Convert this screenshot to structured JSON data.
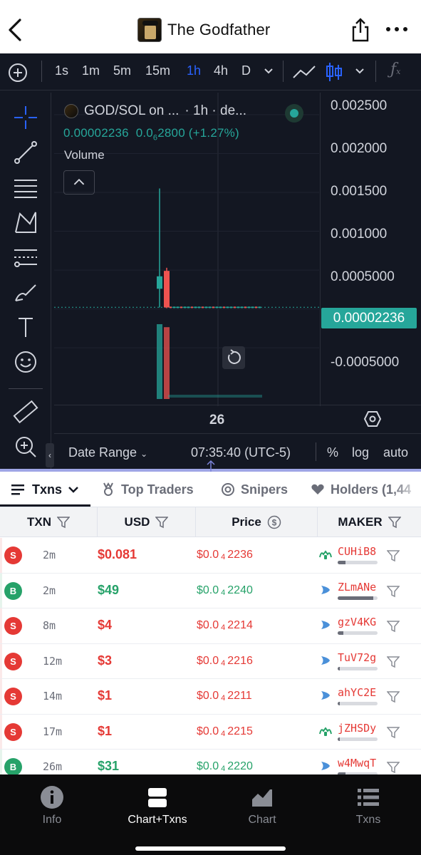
{
  "header": {
    "title": "The Godfather",
    "back_icon": "chevron-left-icon",
    "share_icon": "share-icon",
    "more_icon": "more-dots-icon"
  },
  "chart_toolbar": {
    "add_icon": "plus-circle-icon",
    "intervals": [
      "1s",
      "1m",
      "5m",
      "15m",
      "1h",
      "4h",
      "D"
    ],
    "active_interval": "1h",
    "interval_dropdown_icon": "chevron-down-icon",
    "chart_style_icon": "line-chart-icon",
    "candles_icon": "candles-icon",
    "indicators_icon": "fx-icon"
  },
  "left_tools": [
    "crosshair-icon",
    "trendline-icon",
    "horizontal-lines-icon",
    "pattern-icon",
    "fib-icon",
    "brush-icon",
    "text-icon",
    "emoji-icon",
    "ruler-icon",
    "zoom-in-icon"
  ],
  "chart_legend": {
    "symbol": "GOD/SOL on ...",
    "interval_source": "· 1h · de...",
    "price": "0.00002236",
    "change_prefix": "0.0",
    "change_sub": "6",
    "change_rest": "2800 (+1.27%)",
    "volume_label": "Volume"
  },
  "y_axis_labels": [
    "0.002500",
    "0.002000",
    "0.001500",
    "0.001000",
    "0.0005000",
    "-0.0005000"
  ],
  "last_price_label": "0.00002236",
  "x_axis_label": "26",
  "chart_footer": {
    "date_range": "Date Range",
    "time": "07:35:40 (UTC-5)",
    "percent": "%",
    "log": "log",
    "auto": "auto"
  },
  "chart_data": {
    "type": "candlestick",
    "ylim": [
      -0.0007,
      0.0026
    ],
    "y_ticks": [
      0.0025,
      0.002,
      0.0015,
      0.001,
      0.0005,
      -0.0005
    ],
    "last_price": 2.236e-05,
    "candles": [
      {
        "open": 0.00026,
        "close": 0.00042,
        "high": 0.00155,
        "low": 2e-05,
        "color": "green"
      },
      {
        "open": 0.00049,
        "close": 2e-05,
        "high": 0.00053,
        "low": 1e-05,
        "color": "red"
      }
    ],
    "volumes": [
      {
        "value": 1.0,
        "color": "green"
      },
      {
        "value": 0.96,
        "color": "red"
      }
    ]
  },
  "tabs": [
    {
      "label": "Txns",
      "icon": "list-icon"
    },
    {
      "label": "Top Traders",
      "icon": "medal-icon"
    },
    {
      "label": "Snipers",
      "icon": "target-icon"
    },
    {
      "label": "Holders (1,44",
      "icon": "heart-icon"
    }
  ],
  "table": {
    "headers": {
      "txn": "TXN",
      "usd": "USD",
      "price": "Price",
      "maker": "MAKER"
    },
    "rows": [
      {
        "type": "S",
        "age": "2m",
        "usd": "$0.081",
        "price_prefix": "$0.0",
        "price_sub": "4",
        "price_rest": "2236",
        "maker": "CUHiB8",
        "maker_icon": "frog-icon",
        "bar": 0.2
      },
      {
        "type": "B",
        "age": "2m",
        "usd": "$49",
        "price_prefix": "$0.0",
        "price_sub": "4",
        "price_rest": "2240",
        "maker": "ZLmANe",
        "maker_icon": "dolphin-icon",
        "bar": 0.9
      },
      {
        "type": "S",
        "age": "8m",
        "usd": "$4",
        "price_prefix": "$0.0",
        "price_sub": "4",
        "price_rest": "2214",
        "maker": "gzV4KG",
        "maker_icon": "dolphin-icon",
        "bar": 0.15
      },
      {
        "type": "S",
        "age": "12m",
        "usd": "$3",
        "price_prefix": "$0.0",
        "price_sub": "4",
        "price_rest": "2216",
        "maker": "TuV72g",
        "maker_icon": "dolphin-icon",
        "bar": 0.05
      },
      {
        "type": "S",
        "age": "14m",
        "usd": "$1",
        "price_prefix": "$0.0",
        "price_sub": "4",
        "price_rest": "2211",
        "maker": "ahYC2E",
        "maker_icon": "dolphin-icon",
        "bar": 0.05
      },
      {
        "type": "S",
        "age": "17m",
        "usd": "$1",
        "price_prefix": "$0.0",
        "price_sub": "4",
        "price_rest": "2215",
        "maker": "jZHSDy",
        "maker_icon": "frog-icon",
        "bar": 0.05
      },
      {
        "type": "B",
        "age": "26m",
        "usd": "$31",
        "price_prefix": "$0.0",
        "price_sub": "4",
        "price_rest": "2220",
        "maker": "w4MwqT",
        "maker_icon": "dolphin-icon",
        "bar": 0.2
      }
    ]
  },
  "bottom_nav": [
    {
      "label": "Info",
      "icon": "info-icon"
    },
    {
      "label": "Chart+Txns",
      "icon": "split-view-icon",
      "active": true
    },
    {
      "label": "Chart",
      "icon": "area-chart-icon"
    },
    {
      "label": "Txns",
      "icon": "list-icon"
    }
  ],
  "colors": {
    "green": "#26a269",
    "red": "#e53935",
    "chart_bg": "#131722",
    "accent": "#2962ff"
  }
}
